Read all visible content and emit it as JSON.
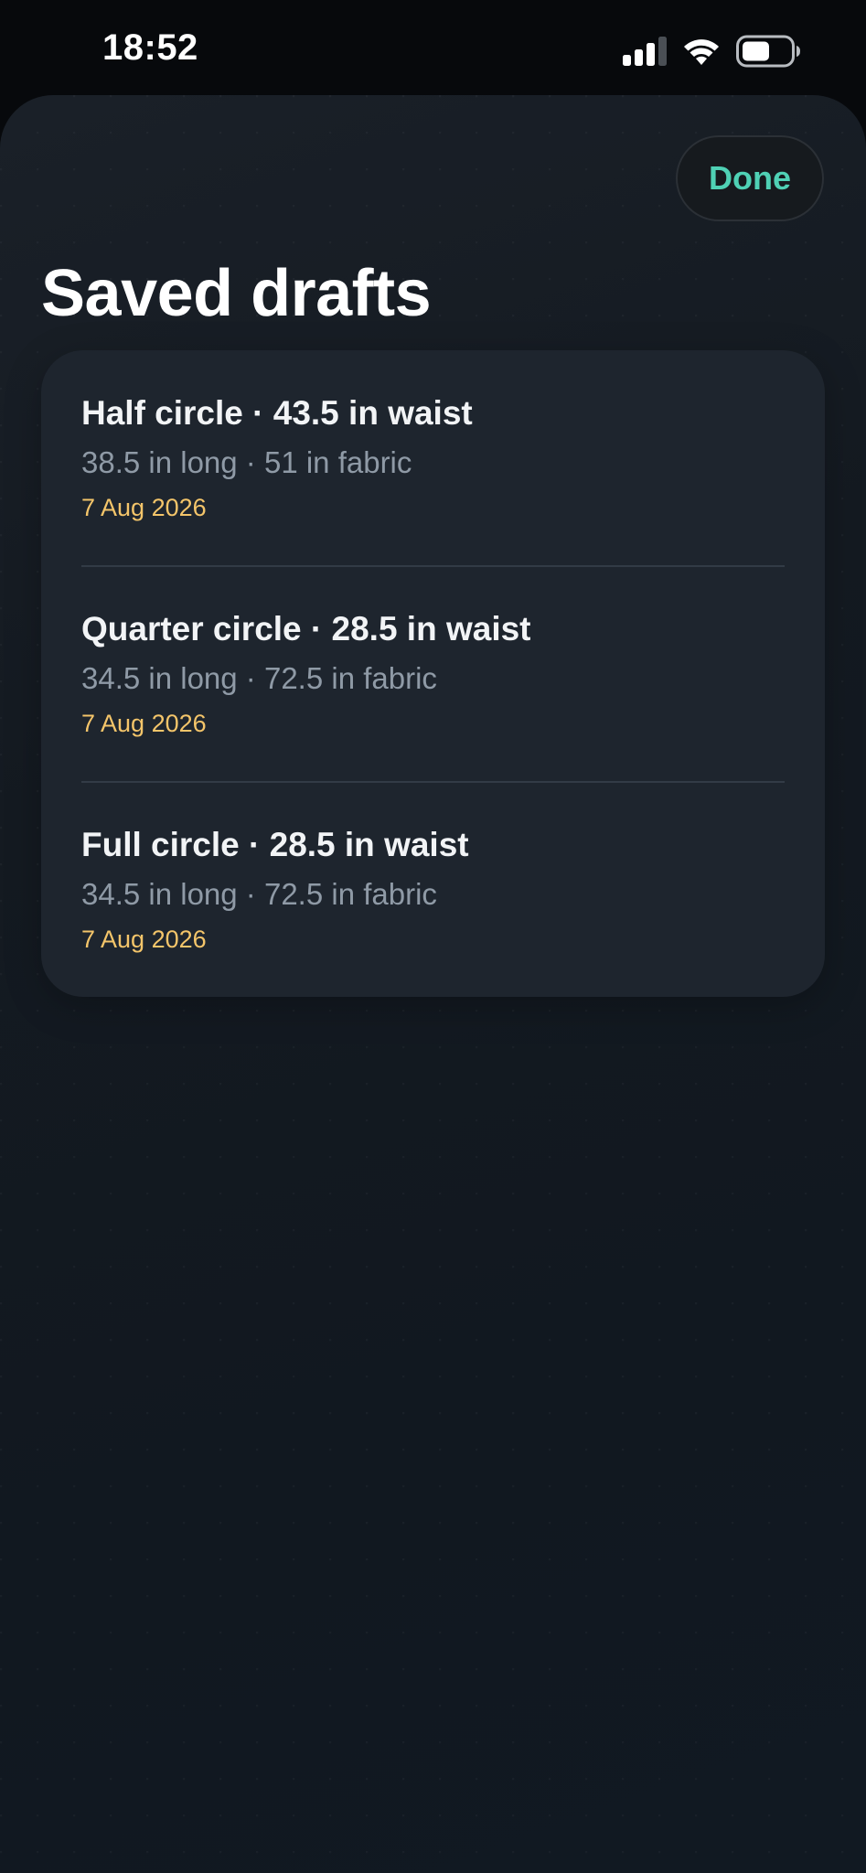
{
  "status_bar": {
    "time": "18:52",
    "icons": [
      "signal-icon",
      "wifi-icon",
      "battery-icon"
    ]
  },
  "header": {
    "done_label": "Done",
    "title": "Saved drafts"
  },
  "drafts": [
    {
      "title": "Half circle · 43.5 in waist",
      "detail": "38.5 in long · 51 in fabric",
      "date": "7 Aug 2026"
    },
    {
      "title": "Quarter circle · 28.5 in waist",
      "detail": "34.5 in long · 72.5 in fabric",
      "date": "7 Aug 2026"
    },
    {
      "title": "Full circle · 28.5 in waist",
      "detail": "34.5 in long · 72.5 in fabric",
      "date": "7 Aug 2026"
    }
  ],
  "colors": {
    "accent": "#4fd1b5",
    "date": "#f4c56a",
    "card": "#1e252e",
    "background": "#141a21"
  }
}
